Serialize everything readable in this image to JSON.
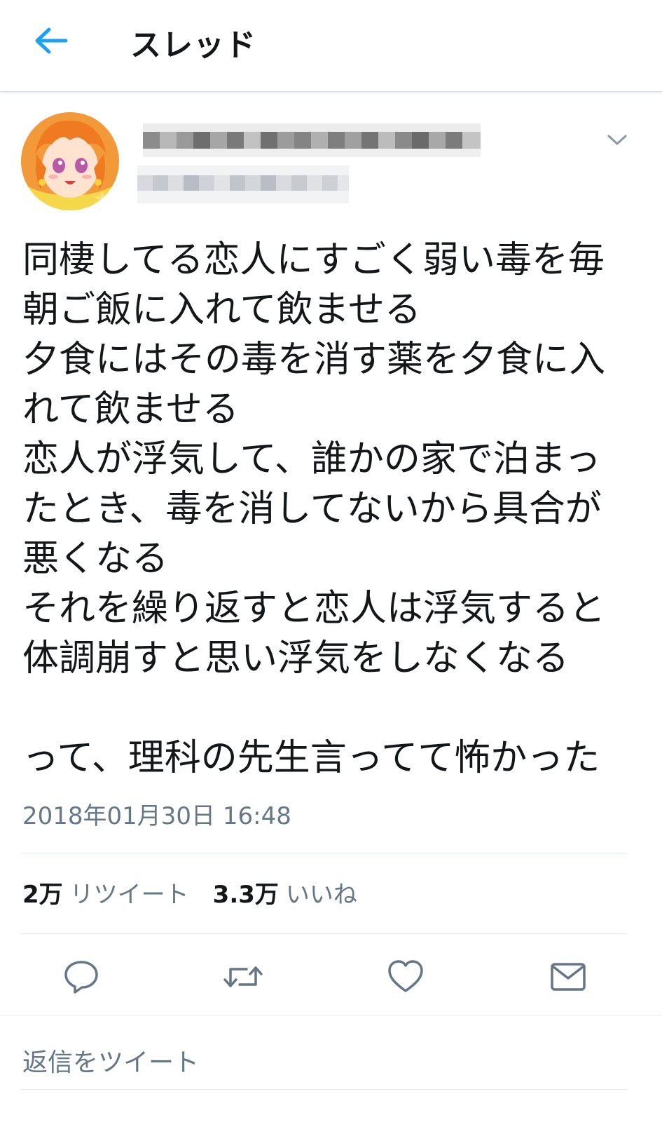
{
  "header": {
    "title": "スレッド",
    "back_icon": "arrow-left-icon"
  },
  "tweet": {
    "author_name": "",
    "author_handle": "",
    "text": "同棲してる恋人にすごく弱い毒を毎\n朝ご飯に入れて飲ませる\n夕食にはその毒を消す薬を夕食に入\nれて飲ませる\n恋人が浮気して、誰かの家で泊まっ\nたとき、毒を消してないから具合が\n悪くなる\nそれを繰り返すと恋人は浮気すると\n体調崩すと思い浮気をしなくなる\n\nって、理科の先生言ってて怖かった",
    "timestamp": "2018年01月30日 16:48"
  },
  "stats": {
    "retweet_count": "2万",
    "retweet_label": "リツイート",
    "like_count": "3.3万",
    "like_label": "いいね"
  },
  "actions": [
    "reply-icon",
    "retweet-icon",
    "like-icon",
    "share-mail-icon"
  ],
  "reply": {
    "placeholder": "返信をツイート"
  },
  "colors": {
    "accent": "#1da1f2",
    "secondary_text": "#657786",
    "primary_text": "#14171a",
    "divider": "#e1e8ed"
  }
}
